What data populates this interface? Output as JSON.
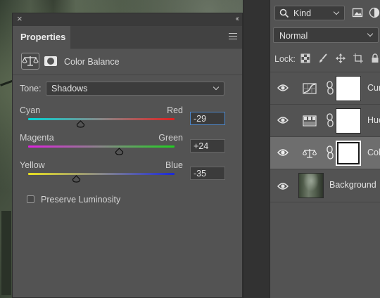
{
  "properties": {
    "tab_label": "Properties",
    "adjustment_title": "Color Balance",
    "tone_label": "Tone:",
    "tone_value": "Shadows",
    "sliders": [
      {
        "left": "Cyan",
        "right": "Red",
        "value": "-29",
        "level": -29,
        "colors": [
          "#00d6d6",
          "#e02020"
        ],
        "active": true
      },
      {
        "left": "Magenta",
        "right": "Green",
        "value": "+24",
        "level": 24,
        "colors": [
          "#e020e0",
          "#20d020"
        ],
        "active": false
      },
      {
        "left": "Yellow",
        "right": "Blue",
        "value": "-35",
        "level": -35,
        "colors": [
          "#e8e020",
          "#1a28d8"
        ],
        "active": false
      }
    ],
    "preserve_luminosity_label": "Preserve Luminosity",
    "preserve_luminosity_checked": false
  },
  "layers": {
    "filter_kind_label": "Kind",
    "blend_mode": "Normal",
    "lock_label": "Lock:",
    "items": [
      {
        "name": "Cur",
        "type": "curves",
        "selected": false
      },
      {
        "name": "Hue",
        "type": "hue-saturation",
        "selected": false
      },
      {
        "name": "Col",
        "type": "color-balance",
        "selected": true
      },
      {
        "name": "Background",
        "type": "image",
        "selected": false
      }
    ]
  }
}
